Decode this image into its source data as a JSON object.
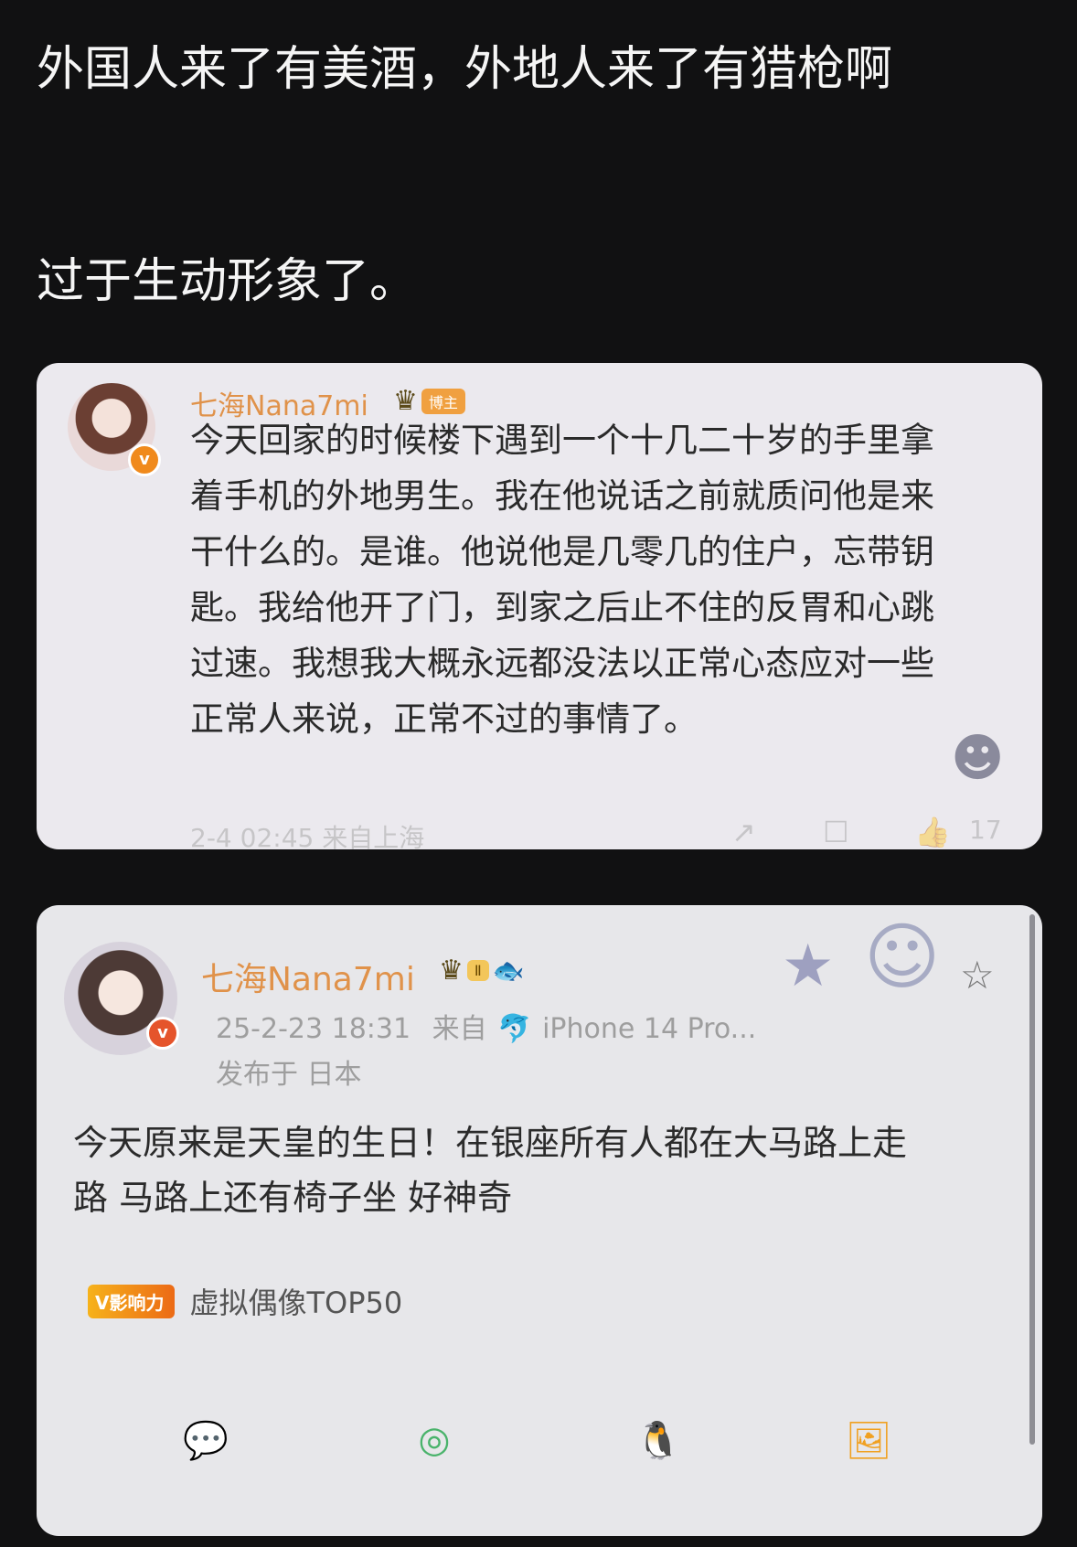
{
  "post": {
    "title": "外国人来了有美酒，外地人来了有猎枪啊",
    "subtitle": "过于生动形象了。"
  },
  "card1": {
    "username": "七海Nana7mi",
    "tag": "博主",
    "verified": "v",
    "text": "今天回家的时候楼下遇到一个十几二十岁的手里拿着手机的外地男生。我在他说话之前就质问他是来干什么的。是谁。他说他是几零几的住户，忘带钥匙。我给他开了门，到家之后止不住的反胃和心跳过速。我想我大概永远都没法以正常心态应对一些正常人来说，正常不过的事情了。",
    "meta": "2-4 02:45  来自上海",
    "actions": {
      "share": "↗",
      "comment": "☐",
      "like": "👍",
      "count": "17"
    }
  },
  "card2": {
    "username": "七海Nana7mi",
    "level": "Ⅱ",
    "verified": "v",
    "timestamp": "25-2-23 18:31",
    "source_prefix": "来自",
    "source_device": "iPhone 14 Pro...",
    "location": "发布于 日本",
    "text": "今天原来是天皇的生日！在银座所有人都在大马路上走路 马路上还有椅子坐 好神奇",
    "badge_logo": "V影响力",
    "badge_text": "虚拟偶像TOP50",
    "star": "☆",
    "share_icons": [
      "wechat-icon",
      "moments-icon",
      "qq-icon",
      "save-image-icon"
    ]
  },
  "colors": {
    "background": "#111112",
    "card": "#e9e8ee",
    "username": "#e08a3c",
    "wechat": "#4ab36b",
    "moments": "#4ab36b",
    "qq": "#2b8be6",
    "save": "#f0a020"
  }
}
